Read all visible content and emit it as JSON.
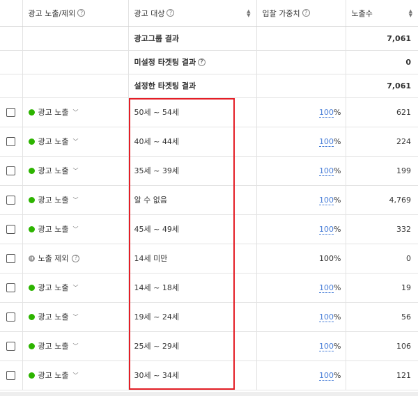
{
  "header": {
    "status_label": "광고 노출/제외",
    "target_label": "광고 대상",
    "bid_label": "입찰 가중치",
    "imp_label": "노출수"
  },
  "summary": [
    {
      "label": "광고그룹 결과",
      "value": "7,061",
      "has_help": false
    },
    {
      "label": "미설정 타겟팅 결과",
      "value": "0",
      "has_help": true
    },
    {
      "label": "설정한 타겟팅 결과",
      "value": "7,061",
      "has_help": false
    }
  ],
  "rows": [
    {
      "status": "광고 노출",
      "type": "on",
      "target": "50세 ~ 54세",
      "bid_num": "100",
      "imp": "621"
    },
    {
      "status": "광고 노출",
      "type": "on",
      "target": "40세 ~ 44세",
      "bid_num": "100",
      "imp": "224"
    },
    {
      "status": "광고 노출",
      "type": "on",
      "target": "35세 ~ 39세",
      "bid_num": "100",
      "imp": "199"
    },
    {
      "status": "광고 노출",
      "type": "on",
      "target": "알 수 없음",
      "bid_num": "100",
      "imp": "4,769"
    },
    {
      "status": "광고 노출",
      "type": "on",
      "target": "45세 ~ 49세",
      "bid_num": "100",
      "imp": "332"
    },
    {
      "status": "노출 제외",
      "type": "off",
      "target": "14세 미만",
      "bid_num": "100",
      "imp": "0"
    },
    {
      "status": "광고 노출",
      "type": "on",
      "target": "14세 ~ 18세",
      "bid_num": "100",
      "imp": "19"
    },
    {
      "status": "광고 노출",
      "type": "on",
      "target": "19세 ~ 24세",
      "bid_num": "100",
      "imp": "56"
    },
    {
      "status": "광고 노출",
      "type": "on",
      "target": "25세 ~ 29세",
      "bid_num": "100",
      "imp": "106"
    },
    {
      "status": "광고 노출",
      "type": "on",
      "target": "30세 ~ 34세",
      "bid_num": "100",
      "imp": "121"
    }
  ],
  "colors": {
    "on_dot": "#2db400",
    "highlight": "#e41e26",
    "link": "#4a7fd8"
  }
}
